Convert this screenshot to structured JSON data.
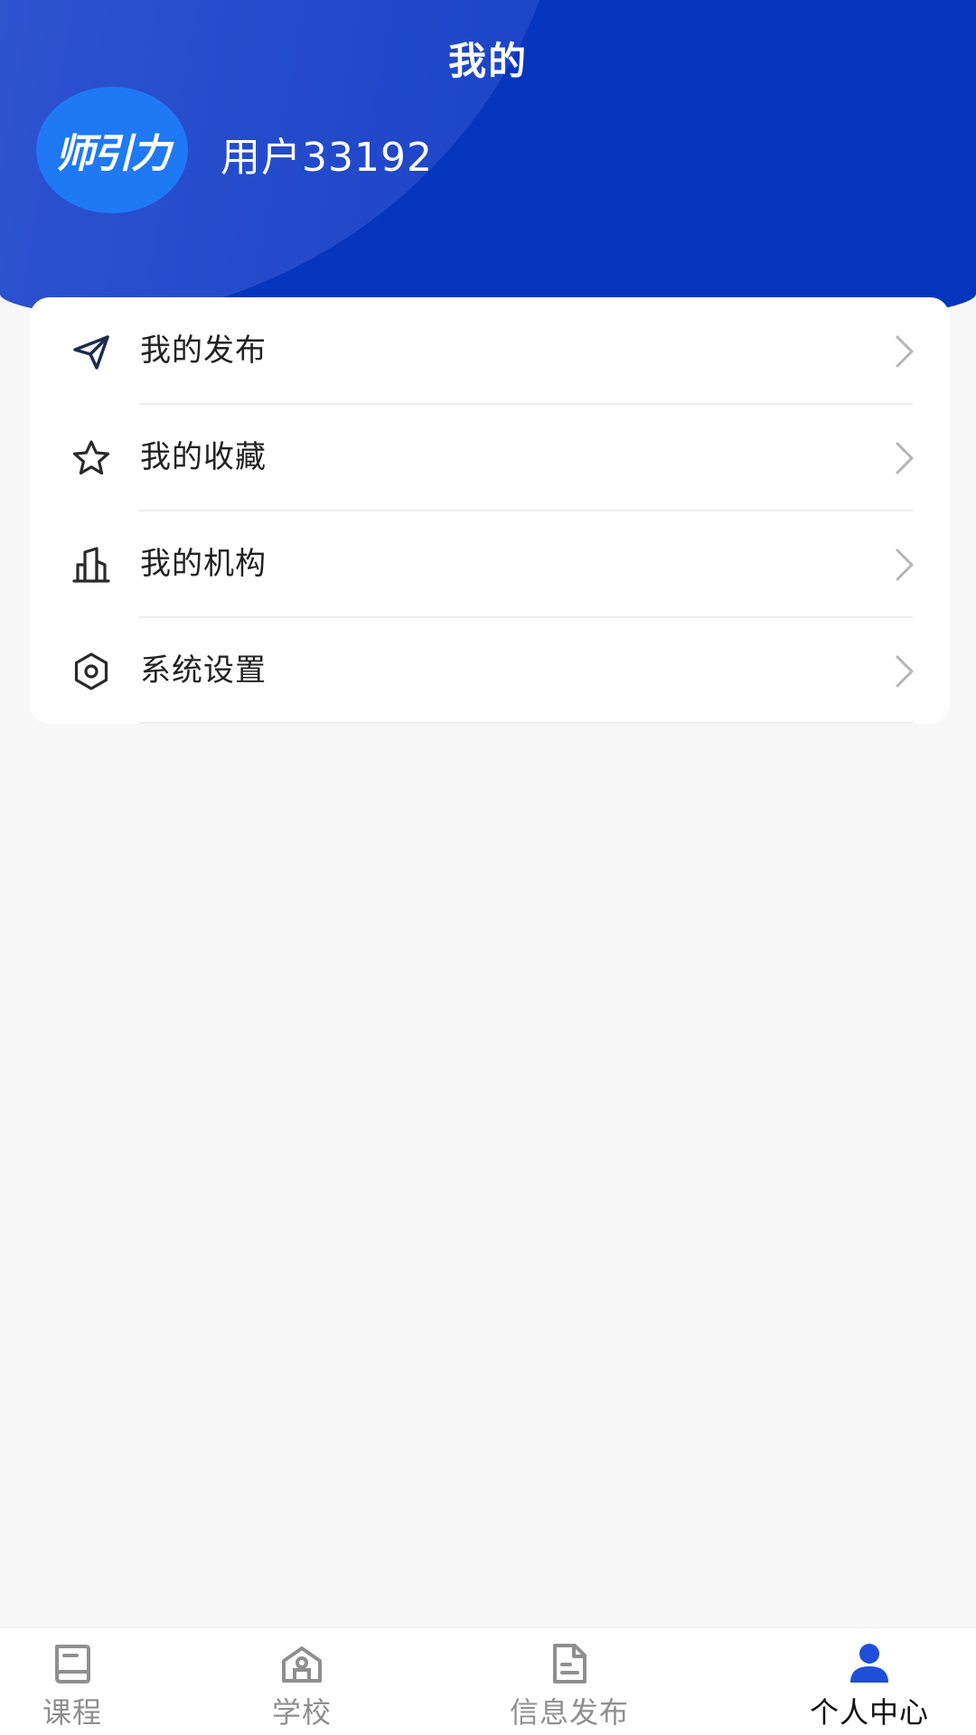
{
  "header": {
    "title": "我的",
    "avatar_logo_text": "师引力",
    "username": "用户33192"
  },
  "menu": {
    "items": [
      {
        "label": "我的发布",
        "icon": "send-icon"
      },
      {
        "label": "我的收藏",
        "icon": "star-icon"
      },
      {
        "label": "我的机构",
        "icon": "building-icon"
      },
      {
        "label": "系统设置",
        "icon": "settings-hexagon-icon"
      }
    ]
  },
  "tabbar": {
    "tabs": [
      {
        "label": "课程",
        "icon": "book-icon",
        "active": false
      },
      {
        "label": "学校",
        "icon": "school-icon",
        "active": false
      },
      {
        "label": "信息发布",
        "icon": "document-icon",
        "active": false
      },
      {
        "label": "个人中心",
        "icon": "person-icon",
        "active": true
      }
    ]
  },
  "colors": {
    "header_blue": "#0536bd",
    "avatar_blue": "#1f79f4",
    "active_tab_icon": "#1f4fd8",
    "inactive_tab": "#8f8f8f",
    "page_background": "#f7f7f7"
  }
}
